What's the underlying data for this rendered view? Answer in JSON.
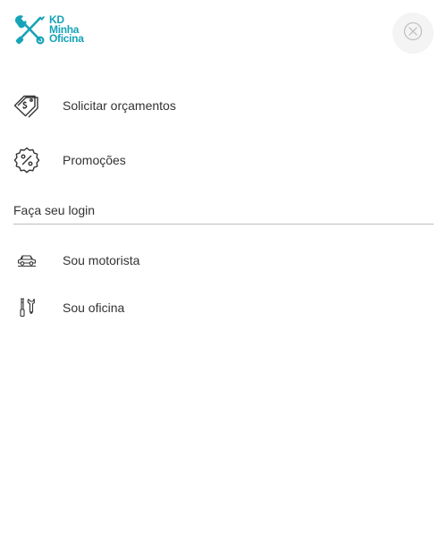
{
  "header": {
    "logo_lines": [
      "KD",
      "Minha",
      "Oficina"
    ],
    "brand_color": "#16a3b8",
    "close_icon": "close-circle-icon"
  },
  "menu": {
    "items": [
      {
        "label": "Solicitar orçamentos",
        "icon": "price-tag-icon"
      },
      {
        "label": "Promoções",
        "icon": "percent-badge-icon"
      }
    ]
  },
  "login": {
    "title": "Faça seu login",
    "items": [
      {
        "label": "Sou motorista",
        "icon": "car-icon"
      },
      {
        "label": "Sou oficina",
        "icon": "tools-icon"
      }
    ]
  }
}
